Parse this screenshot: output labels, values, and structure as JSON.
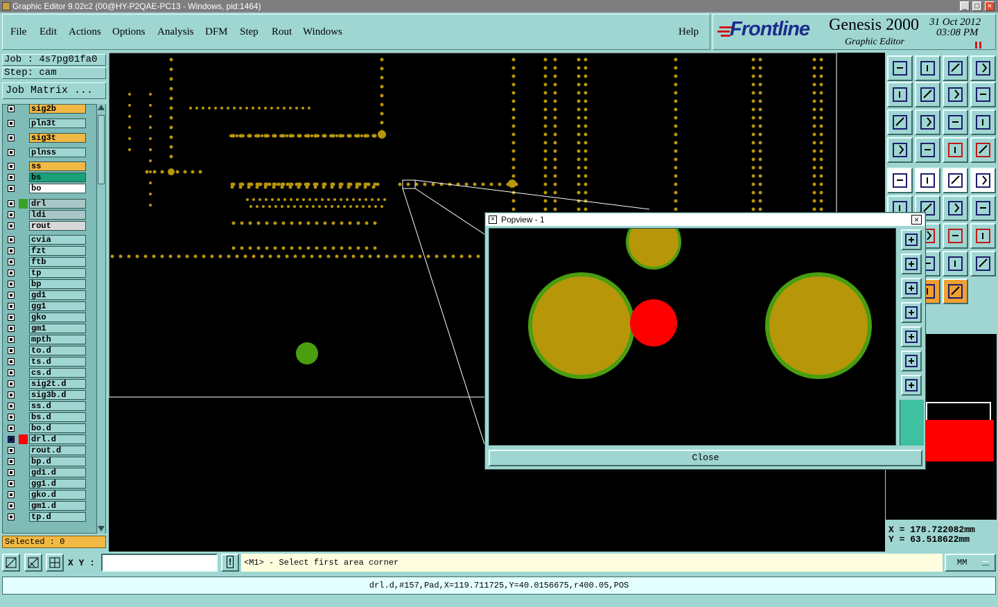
{
  "window": {
    "title": "Graphic Editor 9.02c2 (00@HY-P2QAE-PC13 - Windows, pid:1464)"
  },
  "menu": [
    "File",
    "Edit",
    "Actions",
    "Options",
    "Analysis",
    "DFM",
    "Step",
    "Rout",
    "Windows"
  ],
  "help_label": "Help",
  "logo": {
    "brand": "Frontline",
    "product": "Genesis 2000",
    "subtitle": "Graphic Editor",
    "date": "31 Oct 2012",
    "time": "03:08 PM"
  },
  "job": {
    "job_label": "Job : 4s7pg01fa0",
    "step_label": "Step: cam",
    "matrix_button": "Job Matrix ..."
  },
  "layers_top": [
    {
      "name": "sig2b",
      "color": "#f2b844"
    },
    {
      "name": "pln3t",
      "color": "#9fd6d2"
    },
    {
      "name": "sig3t",
      "color": "#f2b844"
    },
    {
      "name": "plnss",
      "color": "#9fd6d2"
    },
    {
      "name": "ss",
      "color": "#f2b844"
    },
    {
      "name": "bs",
      "color": "#18a078"
    },
    {
      "name": "bo",
      "color": "#ffffff"
    }
  ],
  "layers_drill": [
    {
      "name": "drl",
      "color": "#a8c8c8",
      "swatch": "#3aa02a"
    },
    {
      "name": "ldi",
      "color": "#a8c8c8"
    },
    {
      "name": "rout",
      "color": "#d8d8d8"
    }
  ],
  "layers_misc": [
    "cvia",
    "fzt",
    "ftb",
    "tp",
    "bp",
    "gd1",
    "gg1",
    "gko",
    "gm1",
    "mpth",
    "to.d",
    "ts.d",
    "cs.d",
    "sig2t.d",
    "sig3b.d",
    "ss.d",
    "bs.d",
    "bo.d",
    "drl.d",
    "rout.d",
    "bp.d",
    "gd1.d",
    "gg1.d",
    "gko.d",
    "gm1.d",
    "tp.d"
  ],
  "active_layer": "drl.d",
  "active_color": "#ff0000",
  "selected": "Selected : 0",
  "coords": {
    "x": "X  =  178.722082mm",
    "y": "Y  =  63.518622mm"
  },
  "bottom": {
    "xy_label": "X Y :",
    "xy_value": "",
    "prompt": "<M1> - Select first area corner",
    "units": "MM"
  },
  "status": "drl.d,#157,Pad,X=119.711725,Y=40.0156675,r400.05,POS",
  "popview": {
    "title": "Popview - 1",
    "close_label": "Close"
  },
  "toolbar_icons": [
    "home-icon",
    "pan-down-icon",
    "house-icon",
    "window-icon",
    "pan-left-icon",
    "pan-right-icon",
    "undo-view-icon",
    "redraw-icon",
    "zoom-fit-icon",
    "zoom-center-icon",
    "scale-1-2-icon",
    "help-icon",
    "settings-icon",
    "grid-icon",
    "layers-icon",
    "layers-red-icon",
    "feature-icon",
    "snap-icon",
    "measure-icon",
    "pad-icon",
    "select-icon",
    "delete-icon",
    "move-icon",
    "copy-icon",
    "line-icon",
    "arc-icon",
    "text-icon",
    "polygon-icon",
    "cut-icon",
    "align-icon",
    "group-icon",
    "route-icon",
    "pick-icon",
    "cursor-icon",
    "net-icon"
  ],
  "colors": {
    "bg": "#9fd6d2",
    "pad": "#b8960a",
    "pad_ring": "#4a9e10",
    "highlight": "#ff0000",
    "canvas": "#000000"
  }
}
